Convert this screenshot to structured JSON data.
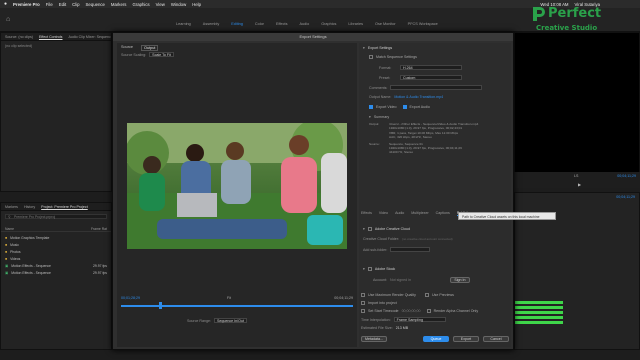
{
  "menubar": {
    "apple": "",
    "app_name": "Premiere Pro",
    "items": [
      "File",
      "Edit",
      "Clip",
      "Sequence",
      "Markers",
      "Graphics",
      "View",
      "Window",
      "Help"
    ],
    "clock": "Wed 10:08 AM",
    "user": "Viral Sutariya"
  },
  "workspace": {
    "tabs": [
      "Learning",
      "Assembly",
      "Editing",
      "Color",
      "Effects",
      "Audio",
      "Graphics",
      "Libraries",
      "Ose Monitor",
      "PFCS Workspace"
    ],
    "active_tab": "Editing"
  },
  "source_panel": {
    "tabs": [
      "Source: (no clips)",
      "Effect Controls",
      "Audio Clip Mixer: Sequenc"
    ],
    "active_tab": "Effect Controls",
    "status": "(no clip selected)"
  },
  "project_panel": {
    "tabs": [
      "Markers",
      "History",
      "Project: Premiere Pro Project"
    ],
    "active_tab": "Project: Premiere Pro Project",
    "search_placeholder": "Premiere Pro Project.prproj",
    "header_name": "Name",
    "header_rate": "Frame Rat",
    "items": [
      {
        "name": "Motion Graphics Template",
        "rate": ""
      },
      {
        "name": "Music",
        "rate": ""
      },
      {
        "name": "Photos",
        "rate": ""
      },
      {
        "name": "Videos",
        "rate": ""
      },
      {
        "name": "Motion Effects - Sequence",
        "rate": "29.97 fps"
      },
      {
        "name": "Motion Effects - Sequence",
        "rate": "29.97 fps"
      }
    ]
  },
  "dialog": {
    "title": "Export Settings",
    "source_tabs": [
      "Source",
      "Output"
    ],
    "active_source_tab": "Output",
    "source_scaling_label": "Source Scaling:",
    "source_scaling_value": "Scale To Fit",
    "timecode_in": "00;01;28;29",
    "timecode_out": "00;04;11;29",
    "fit_label": "Fit",
    "source_range_label": "Source Range:",
    "source_range_value": "Sequence In/Out",
    "export_settings": {
      "header": "Export Settings",
      "match_sequence": "Match Sequence Settings",
      "format_label": "Format:",
      "format_value": "H.264",
      "preset_label": "Preset:",
      "preset_value": "Custom",
      "comments_label": "Comments:",
      "output_name_label": "Output Name:",
      "output_name_value": "Motion & Audio Transition.mp4",
      "export_video": "Export Video",
      "export_audio": "Export Audio",
      "summary_header": "Summary",
      "output_label": "Output:",
      "output_lines": [
        "/Users/.../Other Effects - Sequence/Video & Audio Transition.mp4",
        "1920x1080 (1.0), 29.97 fps, Progressive, 00;02;43;01",
        "VBR, 1 pass, Target 10.00 Mbps, Max 12.00 Mbps",
        "AAC, 320 kbps, 48 kHz, Stereo"
      ],
      "source_label": "Source:",
      "source_lines": [
        "Sequence, Sequence 01",
        "1920x1080 (1.0), 29.97 fps, Progressive, 00;04;11;29",
        "44100 Hz, Stereo"
      ]
    },
    "export_tabs": [
      "Effects",
      "Video",
      "Audio",
      "Multiplexer",
      "Captions",
      "Publish"
    ],
    "active_export_tab": "Publish",
    "creative_cloud": {
      "label": "Adobe Creative Cloud",
      "folder_label": "Creative Cloud Folder:",
      "folder_value": "(no creative cloud account connected)",
      "subfolder_label": "Add sub-folder:"
    },
    "adobe_stock": {
      "label": "Adobe Stock",
      "account_label": "Account:",
      "account_value": "Not signed in",
      "sign_in": "Sign In"
    },
    "tooltip": "Path to Creative Cloud assets on this local machine",
    "options": {
      "max_render": "Use Maximum Render Quality",
      "use_previews": "Use Previews",
      "import_project": "Import into project",
      "start_timecode": "Set Start Timecode",
      "start_timecode_value": "00;00;00;00",
      "render_alpha": "Render Alpha Channel Only",
      "time_interp_label": "Time Interpolation:",
      "time_interp_value": "Frame Sampling",
      "file_size_label": "Estimated File Size:",
      "file_size_value": "213 MB"
    },
    "buttons": {
      "metadata": "Metadata...",
      "queue": "Queue",
      "export": "Export",
      "cancel": "Cancel"
    }
  },
  "timeline": {
    "timecode": "00;04;11;29",
    "right_timecode": "00;04;11;29",
    "channel": "LS"
  },
  "logo": {
    "brand_top": "Perfect",
    "brand_bottom": "Creative Studio",
    "color": "#2aa14a"
  },
  "colors": {
    "accent": "#2d8ceb",
    "meter": "#3fd64a"
  }
}
